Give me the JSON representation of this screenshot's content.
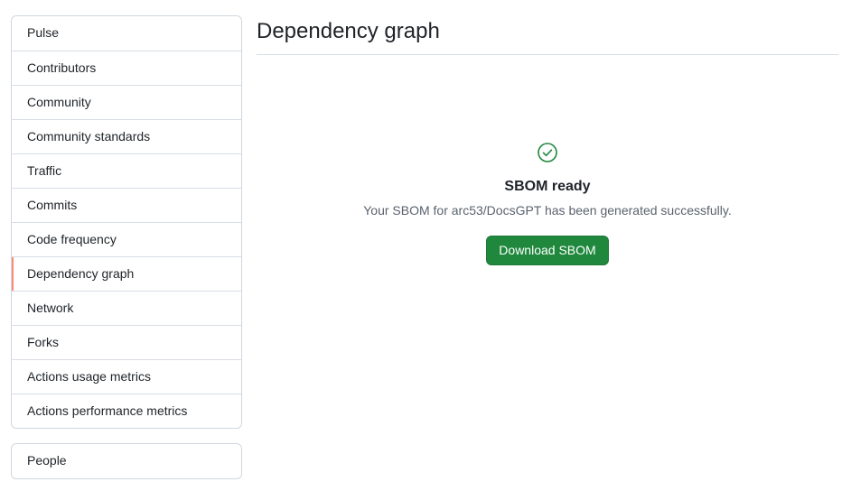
{
  "sidebar": {
    "items": [
      {
        "label": "Pulse"
      },
      {
        "label": "Contributors"
      },
      {
        "label": "Community"
      },
      {
        "label": "Community standards"
      },
      {
        "label": "Traffic"
      },
      {
        "label": "Commits"
      },
      {
        "label": "Code frequency"
      },
      {
        "label": "Dependency graph",
        "selected": true
      },
      {
        "label": "Network"
      },
      {
        "label": "Forks"
      },
      {
        "label": "Actions usage metrics"
      },
      {
        "label": "Actions performance metrics"
      }
    ],
    "secondary_items": [
      {
        "label": "People"
      }
    ]
  },
  "main": {
    "title": "Dependency graph",
    "status": {
      "icon": "check-circle-icon",
      "title": "SBOM ready",
      "description": "Your SBOM for arc53/DocsGPT has been generated successfully.",
      "button_label": "Download SBOM"
    }
  },
  "colors": {
    "accent_green": "#1f883d",
    "selected_indicator": "#fd8c73",
    "muted_text": "#59636e"
  }
}
